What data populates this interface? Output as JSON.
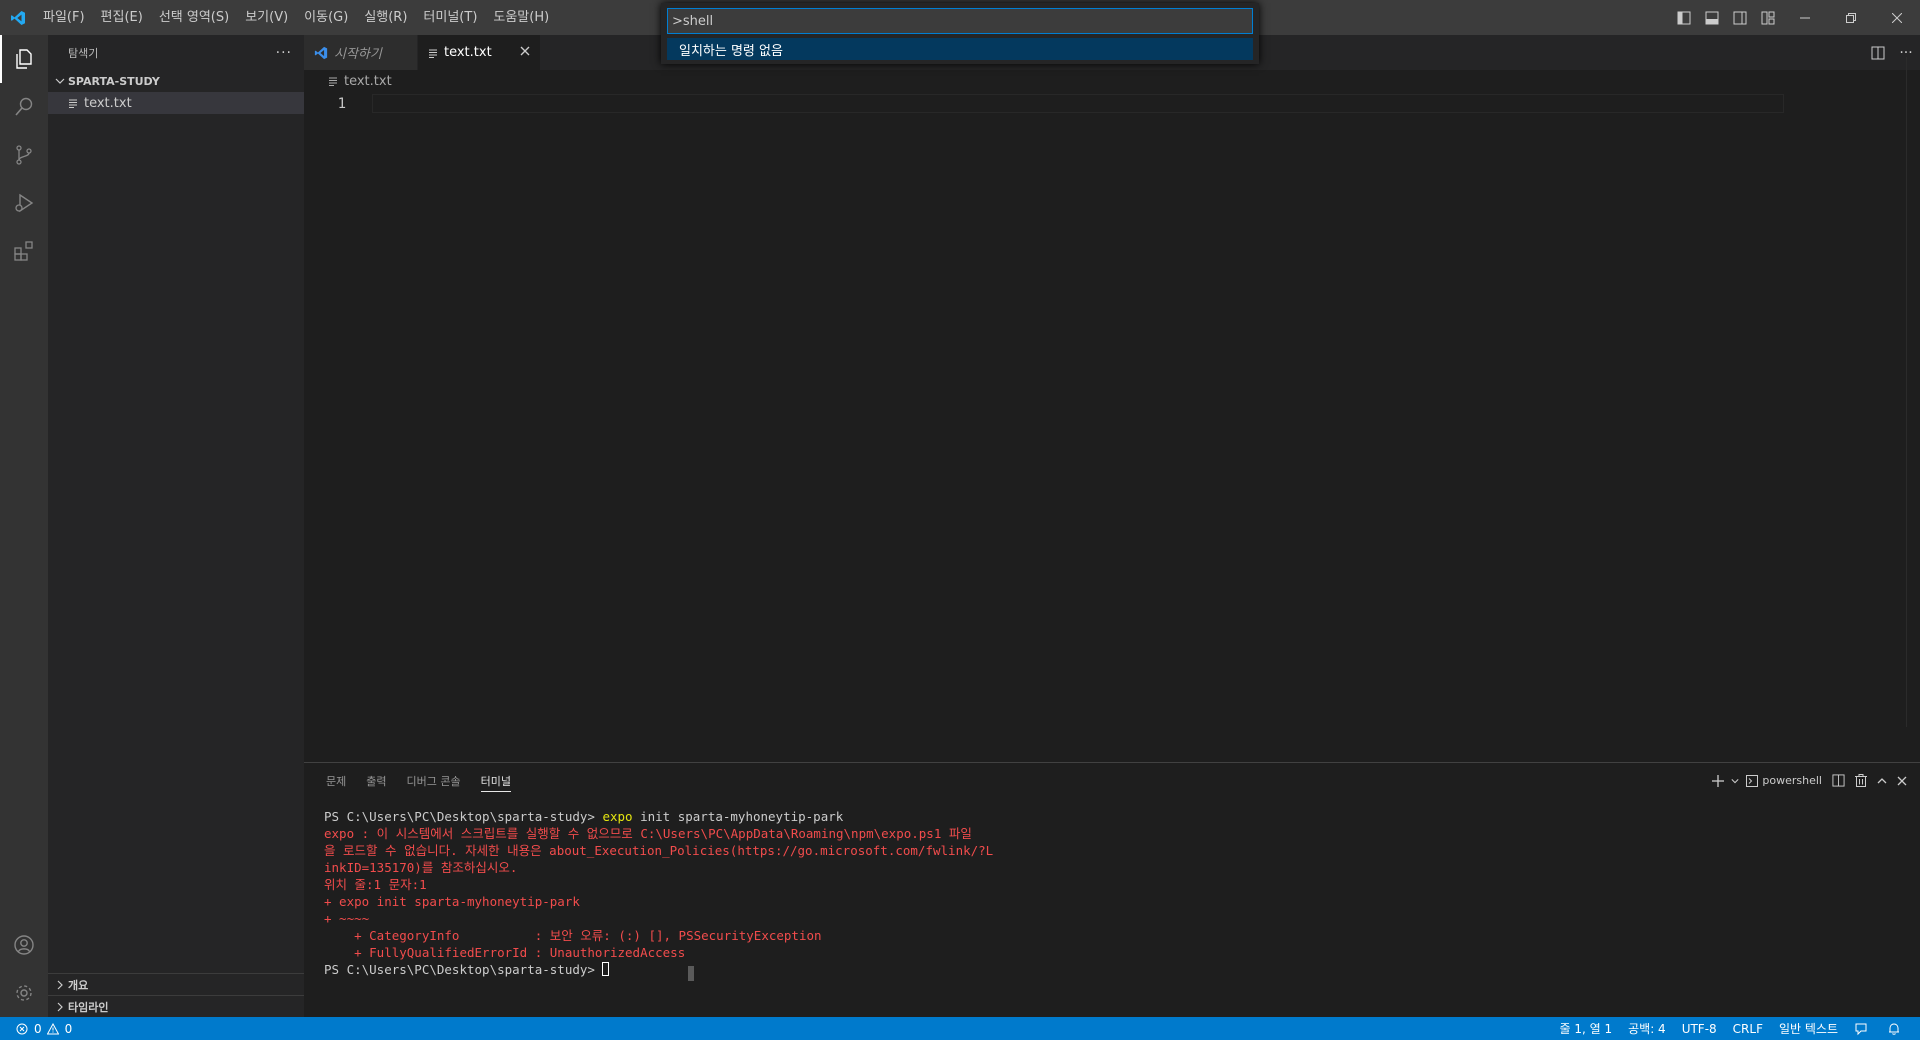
{
  "menu": {
    "items": [
      "파일(F)",
      "편집(E)",
      "선택 영역(S)",
      "보기(V)",
      "이동(G)",
      "실행(R)",
      "터미널(T)",
      "도움말(H)"
    ]
  },
  "command_palette": {
    "input_value": ">shell",
    "result": "일치하는 명령 없음"
  },
  "sidebar": {
    "title": "탐색기",
    "more": "···",
    "folder": "SPARTA-STUDY",
    "files": [
      "text.txt"
    ],
    "bottom_sections": [
      "개요",
      "타임라인"
    ]
  },
  "tabs": [
    {
      "label": "시작하기",
      "active": false
    },
    {
      "label": "text.txt",
      "active": true
    }
  ],
  "breadcrumb": "text.txt",
  "editor": {
    "line_numbers": [
      "1"
    ]
  },
  "panel": {
    "tabs": [
      "문제",
      "출력",
      "디버그 콘솔",
      "터미널"
    ],
    "active_tab": "터미널",
    "terminal_name": "powershell"
  },
  "terminal": {
    "prompt1": "PS C:\\Users\\PC\\Desktop\\sparta-study> ",
    "cmd_keyword": "expo",
    "cmd_rest": " init sparta-myhoneytip-park",
    "error_lines": [
      "expo : 이 시스템에서 스크립트를 실행할 수 없으므로 C:\\Users\\PC\\AppData\\Roaming\\npm\\expo.ps1 파일",
      "을 로드할 수 없습니다. 자세한 내용은 about_Execution_Policies(https://go.microsoft.com/fwlink/?L",
      "inkID=135170)를 참조하십시오.",
      "위치 줄:1 문자:1",
      "+ expo init sparta-myhoneytip-park",
      "+ ~~~~",
      "    + CategoryInfo          : 보안 오류: (:) [], PSSecurityException",
      "    + FullyQualifiedErrorId : UnauthorizedAccess"
    ],
    "prompt2": "PS C:\\Users\\PC\\Desktop\\sparta-study> "
  },
  "statusbar": {
    "errors": "0",
    "warnings": "0",
    "position": "줄 1, 열 1",
    "spaces": "공백: 4",
    "encoding": "UTF-8",
    "eol": "CRLF",
    "language": "일반 텍스트"
  },
  "colors": {
    "accent": "#007acc",
    "title_bar": "#3c3c3c",
    "activity_bar": "#333333",
    "sidebar": "#252526",
    "editor": "#1e1e1e",
    "terminal_error": "#f14c4c",
    "terminal_keyword": "#e5e510"
  }
}
